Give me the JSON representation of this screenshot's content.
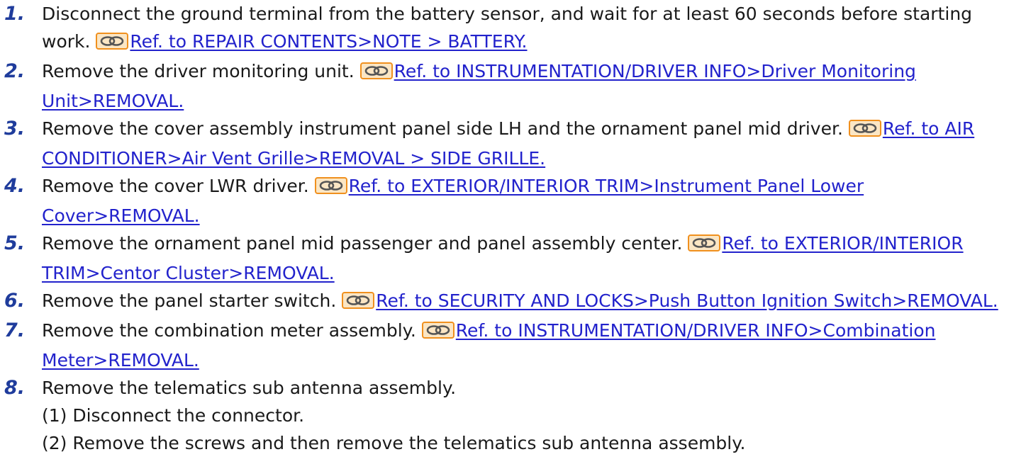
{
  "colors": {
    "step_number": "#1f3c9c",
    "link": "#2222cc",
    "ref_icon_border": "#f0901e",
    "ref_icon_fill": "#fbe6c4",
    "text": "#1a1a1a"
  },
  "ref_icon_name": "chain-link-icon",
  "steps": [
    {
      "number": "1.",
      "text": "Disconnect the ground terminal from the battery sensor, and wait for at least 60 seconds before starting work. ",
      "ref": "Ref. to REPAIR CONTENTS>NOTE > BATTERY."
    },
    {
      "number": "2.",
      "text": "Remove the driver monitoring unit. ",
      "ref": "Ref. to INSTRUMENTATION/DRIVER INFO>Driver Monitoring Unit>REMOVAL."
    },
    {
      "number": "3.",
      "text": "Remove the cover assembly instrument panel side LH and the ornament panel mid driver. ",
      "ref": "Ref. to AIR CONDITIONER>Air Vent Grille>REMOVAL > SIDE GRILLE."
    },
    {
      "number": "4.",
      "text": "Remove the cover LWR driver. ",
      "ref": "Ref. to EXTERIOR/INTERIOR TRIM>Instrument Panel Lower Cover>REMOVAL."
    },
    {
      "number": "5.",
      "text": "Remove the ornament panel mid passenger and panel assembly center. ",
      "ref": "Ref. to EXTERIOR/INTERIOR TRIM>Centor Cluster>REMOVAL."
    },
    {
      "number": "6.",
      "text": "Remove the panel starter switch. ",
      "ref": "Ref. to SECURITY AND LOCKS>Push Button Ignition Switch>REMOVAL."
    },
    {
      "number": "7.",
      "text": "Remove the combination meter assembly. ",
      "ref": "Ref. to INSTRUMENTATION/DRIVER INFO>Combination Meter>REMOVAL."
    },
    {
      "number": "8.",
      "text": "Remove the telematics sub antenna assembly.",
      "substeps": [
        "(1) Disconnect the connector.",
        "(2) Remove the screws and then remove the telematics sub antenna assembly."
      ]
    }
  ]
}
